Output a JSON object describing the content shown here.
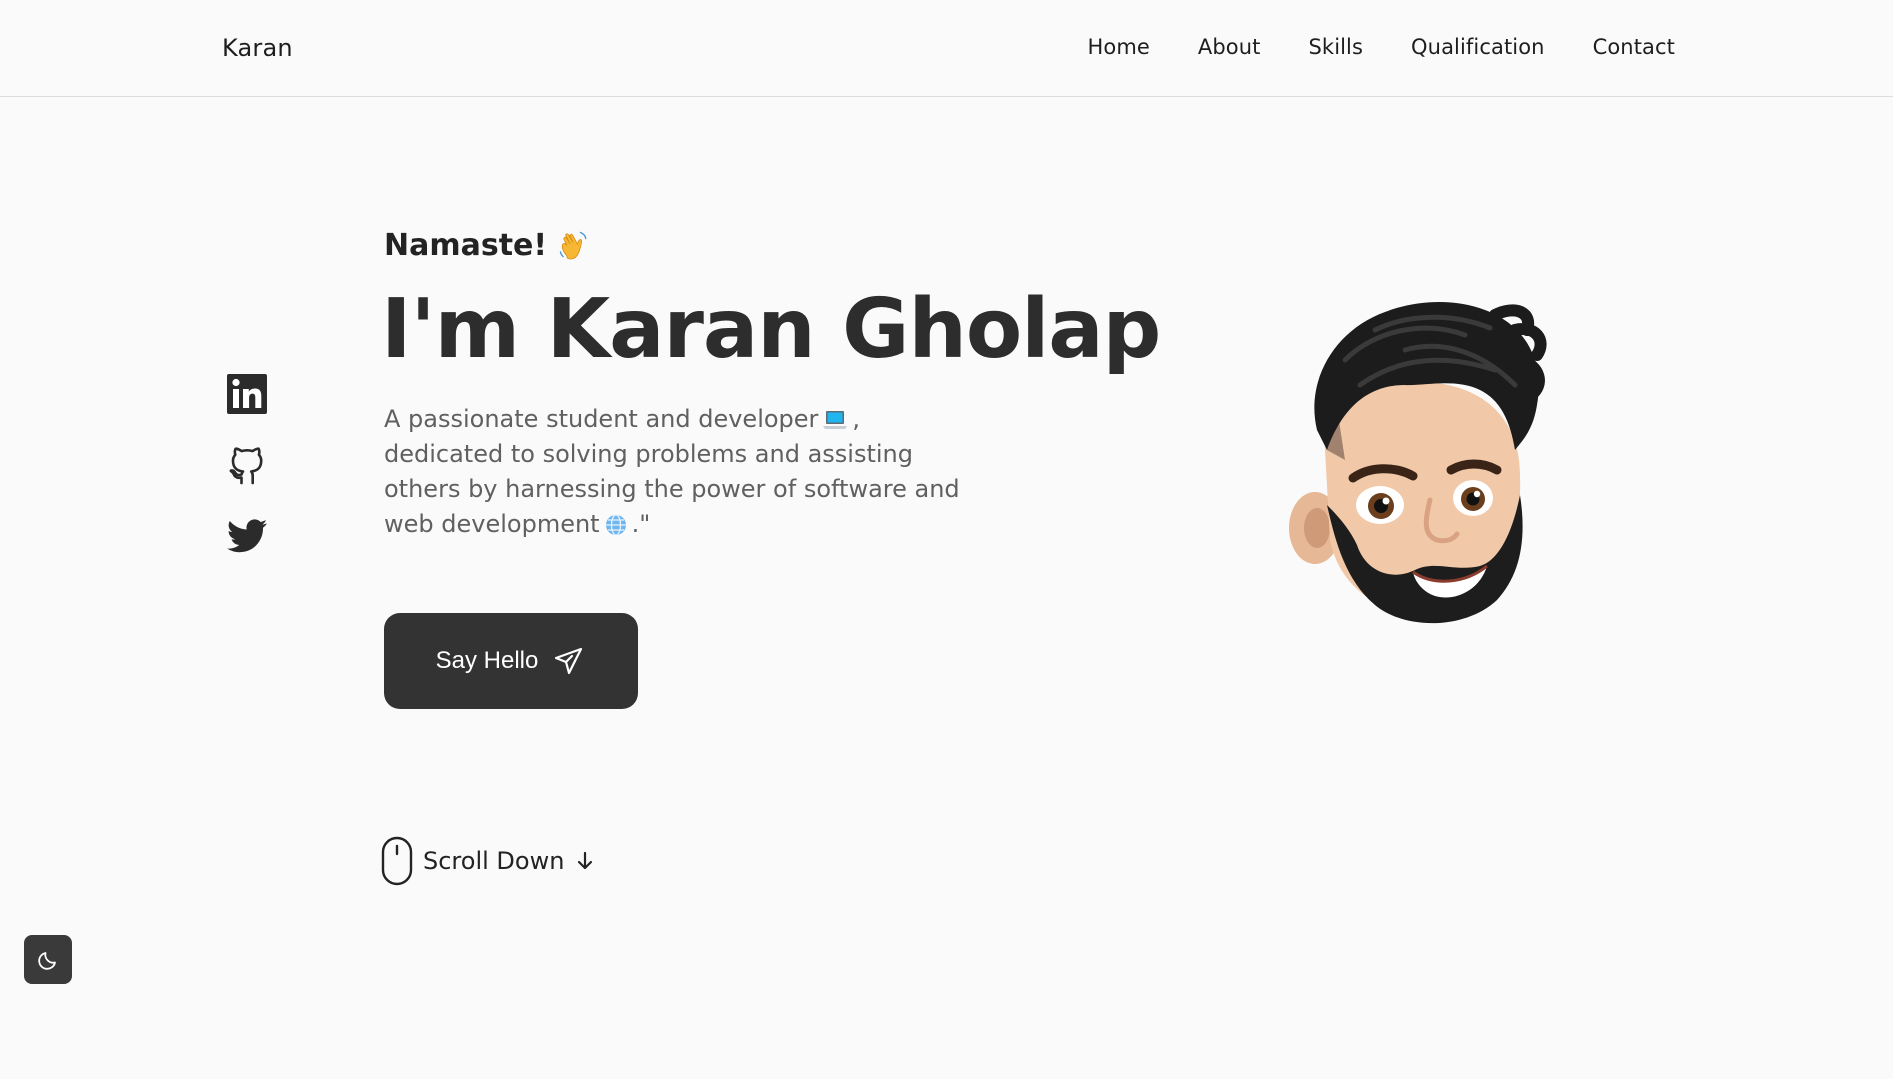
{
  "brand": {
    "logo": "Karan"
  },
  "nav": {
    "items": [
      {
        "label": "Home"
      },
      {
        "label": "About"
      },
      {
        "label": "Skills"
      },
      {
        "label": "Qualification"
      },
      {
        "label": "Contact"
      }
    ]
  },
  "socials": [
    {
      "icon": "linkedin-icon"
    },
    {
      "icon": "github-icon"
    },
    {
      "icon": "twitter-icon"
    }
  ],
  "hero": {
    "greeting": "Namaste!",
    "name": "I'm Karan Gholap",
    "description_lines": [
      "A passionate student and developer",
      "dedicated to solving problems and assisting",
      "others by harnessing the power of software and",
      "web development"
    ],
    "line1_suffix": ",",
    "line4_suffix": ".\"",
    "cta_label": "Say Hello",
    "scroll_label": "Scroll Down"
  },
  "theme": {
    "icon": "moon-icon"
  },
  "colors": {
    "background": "#fafafa",
    "text": "#2d2d2d",
    "muted": "#606060",
    "button": "#333333",
    "button_text": "#ffffff"
  }
}
